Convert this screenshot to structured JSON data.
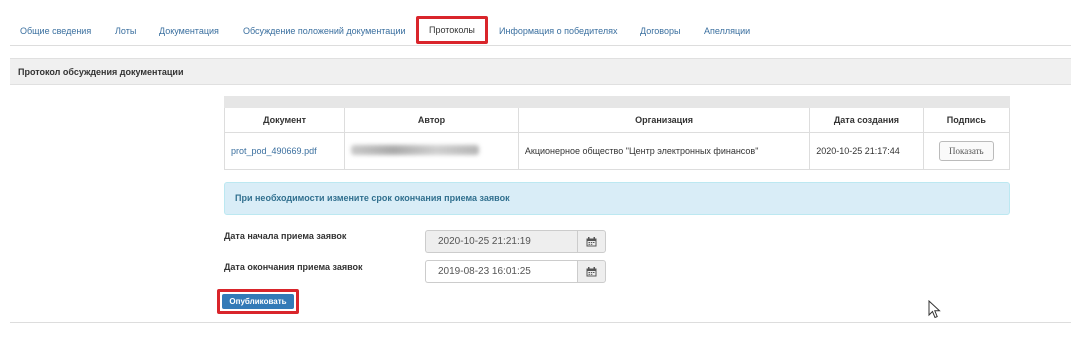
{
  "tabs": [
    {
      "label": "Общие сведения"
    },
    {
      "label": "Лоты"
    },
    {
      "label": "Документация"
    },
    {
      "label": "Обсуждение положений документации"
    },
    {
      "label": "Протоколы",
      "active": true
    },
    {
      "label": "Информация о победителях"
    },
    {
      "label": "Договоры"
    },
    {
      "label": "Апелляции"
    }
  ],
  "section": {
    "title": "Протокол обсуждения документации"
  },
  "documents_table": {
    "headers": [
      "Документ",
      "Автор",
      "Организация",
      "Дата создания",
      "Подпись"
    ],
    "rows": [
      {
        "document": "prot_pod_490669.pdf",
        "author": "",
        "organization": "Акционерное общество \"Центр электронных финансов\"",
        "created": "2020-10-25 21:17:44",
        "sign_button": "Показать"
      }
    ]
  },
  "info": {
    "text": "При необходимости измените срок окончания приема заявок"
  },
  "form": {
    "start_label": "Дата начала приема заявок",
    "start_value": "2020-10-25 21:21:19",
    "end_label": "Дата окончания приема заявок",
    "end_value": "2019-08-23 16:01:25"
  },
  "publish_button": "Опубликовать",
  "icons": {
    "calendar": "calendar-icon",
    "cursor": "mouse-pointer-icon"
  },
  "colors": {
    "link": "#3a6f9f",
    "highlight": "#d9252b",
    "primary": "#337ab7",
    "info_bg": "#d9edf7",
    "info_text": "#31708f"
  }
}
